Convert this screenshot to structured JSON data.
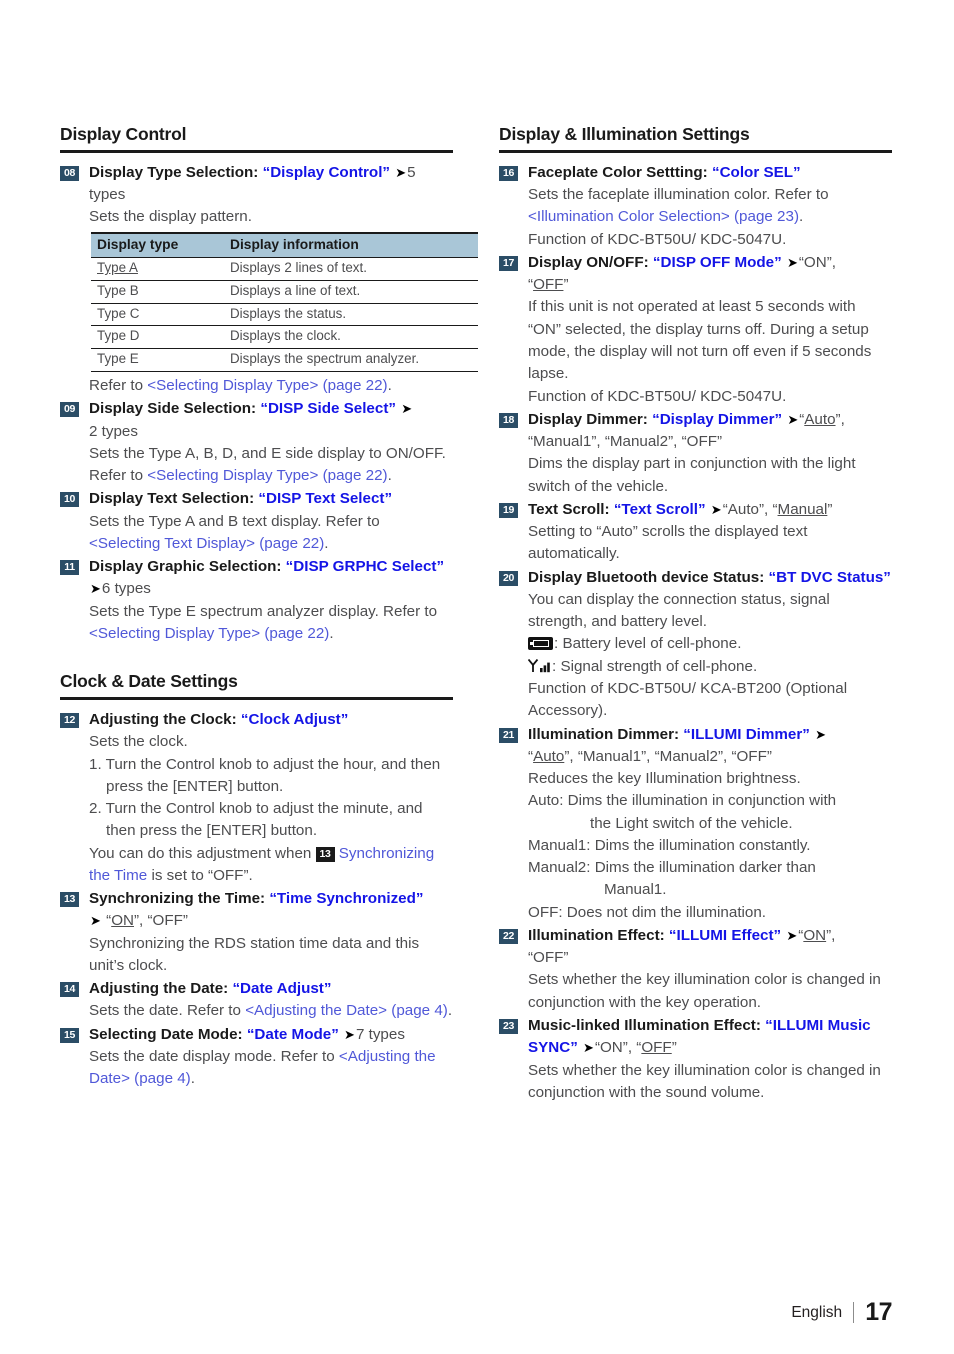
{
  "page": {
    "number": "17",
    "language": "English"
  },
  "left_column": {
    "sections": [
      {
        "heading": "Display Control",
        "items": [
          {
            "badge": "08",
            "title_prefix": "Display Type Selection:",
            "term": "“Display Control”",
            "after_arrow": "5 types",
            "lines": [
              "Sets the display pattern."
            ],
            "table": {
              "headers": [
                "Display type",
                "Display information"
              ],
              "rows": [
                [
                  "Type A",
                  "Displays 2 lines of text."
                ],
                [
                  "Type B",
                  "Displays a line of text."
                ],
                [
                  "Type C",
                  "Displays the status."
                ],
                [
                  "Type D",
                  "Displays the clock."
                ],
                [
                  "Type E",
                  "Displays the spectrum analyzer."
                ]
              ],
              "default_row_label": "Type A"
            },
            "after_table_prefix": "Refer to ",
            "after_table_link": "<Selecting Display Type> (page 22)",
            "after_table_suffix": "."
          },
          {
            "badge": "09",
            "title_prefix": "Display Side Selection:",
            "term": "“DISP Side Select”",
            "after_arrow": "2 types",
            "body_prefix": "Sets the Type A, B, D, and E side display to ON/OFF. Refer to ",
            "body_link": "<Selecting Display Type> (page 22)",
            "body_suffix": "."
          },
          {
            "badge": "10",
            "title_prefix": "Display Text Selection:",
            "term": "“DISP Text Select”",
            "body_prefix": "Sets the Type A and B text display. Refer to ",
            "body_link": "<Selecting Text Display> (page 22)",
            "body_suffix": "."
          },
          {
            "badge": "11",
            "title_prefix": "Display Graphic Selection:",
            "term": "“DISP GRPHC Select”",
            "after_arrow": "6 types",
            "body_prefix": "Sets the Type E spectrum analyzer display. Refer to ",
            "body_link": "<Selecting Display Type> (page 22)",
            "body_suffix": "."
          }
        ]
      },
      {
        "heading": "Clock & Date Settings",
        "items": [
          {
            "badge": "12",
            "title_prefix": "Adjusting the Clock:",
            "term": "“Clock Adjust”",
            "lines": [
              "Sets the clock.",
              "1. Turn the Control knob to adjust the hour, and then press the [ENTER] button.",
              "2. Turn the Control knob to adjust the minute, and then press the [ENTER] button."
            ],
            "note_prefix": "You can do this adjustment when ",
            "note_badge": "13",
            "note_link": "Synchronizing the Time",
            "note_suffix": " is set to “OFF”."
          },
          {
            "badge": "13",
            "title_prefix": "Synchronizing the Time:",
            "term": "“Time Synchronized”",
            "options": "“ON”, “OFF”",
            "option_default": "ON",
            "lines": [
              "Synchronizing the RDS station time data and this unit’s clock."
            ]
          },
          {
            "badge": "14",
            "title_prefix": "Adjusting the Date:",
            "term": "“Date Adjust”",
            "body_prefix": "Sets the date. Refer to ",
            "body_link": "<Adjusting the Date> (page 4)",
            "body_suffix": "."
          },
          {
            "badge": "15",
            "title_prefix": "Selecting Date Mode:",
            "term": "“Date Mode”",
            "after_arrow": "7 types",
            "body_prefix": "Sets the date display mode. Refer to ",
            "body_link": "<Adjusting the Date> (page 4)",
            "body_suffix": "."
          }
        ]
      }
    ]
  },
  "right_column": {
    "sections": [
      {
        "heading": "Display & Illumination Settings",
        "items": [
          {
            "badge": "16",
            "title_prefix": "Faceplate Color Settting:",
            "term": "“Color SEL”",
            "body_prefix": "Sets the faceplate illumination color. Refer to ",
            "body_link": "<Illumination Color Selection> (page 23)",
            "body_suffix": ".",
            "lines": [
              "Function of KDC-BT50U/ KDC-5047U."
            ]
          },
          {
            "badge": "17",
            "title_prefix": "Display ON/OFF:",
            "term": "“DISP OFF Mode”",
            "options_pre": "“ON”,",
            "option_default": "OFF",
            "lines": [
              "If this unit is not operated at least 5 seconds with “ON” selected, the display turns off. During a setup mode, the display will not turn off even if 5 seconds lapse.",
              "Function of KDC-BT50U/ KDC-5047U."
            ]
          },
          {
            "badge": "18",
            "title_prefix": "Display Dimmer:",
            "term": "“Display Dimmer”",
            "option_default": "Auto",
            "options_post": "“Manual1”, “Manual2”, “OFF”",
            "lines": [
              "Dims the display part in conjunction with the light switch of the vehicle."
            ]
          },
          {
            "badge": "19",
            "title_prefix": "Text Scroll:",
            "term": "“Text Scroll”",
            "options_pre": "“Auto”,",
            "option_default": "Manual",
            "lines": [
              "Setting to “Auto” scrolls the displayed text automatically."
            ]
          },
          {
            "badge": "20",
            "title_prefix": "Display Bluetooth device Status:",
            "term": "“BT DVC Status”",
            "lines": [
              "You can display the connection status, signal strength, and battery level."
            ],
            "icon_rows": [
              {
                "icon": "battery-icon",
                "text": ": Battery level of cell-phone."
              },
              {
                "icon": "signal-icon",
                "text": ": Signal strength of cell-phone."
              }
            ],
            "lines_after": [
              "Function of KDC-BT50U/ KCA-BT200 (Optional Accessory)."
            ]
          },
          {
            "badge": "21",
            "title_prefix": "Illumination Dimmer:",
            "term": "“ILLUMI Dimmer”",
            "option_default": "Auto",
            "options_post": "“Manual1”, “Manual2”, “OFF”",
            "lines": [
              "Reduces the key Illumination brightness."
            ],
            "defs": [
              {
                "text": "Auto: Dims the illumination in conjunction with",
                "cont": "the Light switch of the vehicle."
              },
              {
                "text": "Manual1: Dims the illumination constantly."
              },
              {
                "text": "Manual2: Dims the illumination darker than",
                "cont2": "Manual1."
              },
              {
                "text": "OFF: Does not dim the illumination."
              }
            ]
          },
          {
            "badge": "22",
            "title_prefix": "Illumination Effect:",
            "term": "“ILLUMI Effect”",
            "option_default": "ON",
            "options_post_quoted": "“OFF”",
            "lines": [
              "Sets whether the key illumination color is changed in conjunction with the key operation."
            ]
          },
          {
            "badge": "23",
            "title_prefix": "Music-linked Illumination Effect:",
            "term": "“ILLUMI Music SYNC”",
            "options_pre": "“ON”,",
            "option_default": "OFF",
            "lines": [
              "Sets whether the key illumination color is changed in conjunction with the sound volume."
            ]
          }
        ]
      }
    ]
  }
}
